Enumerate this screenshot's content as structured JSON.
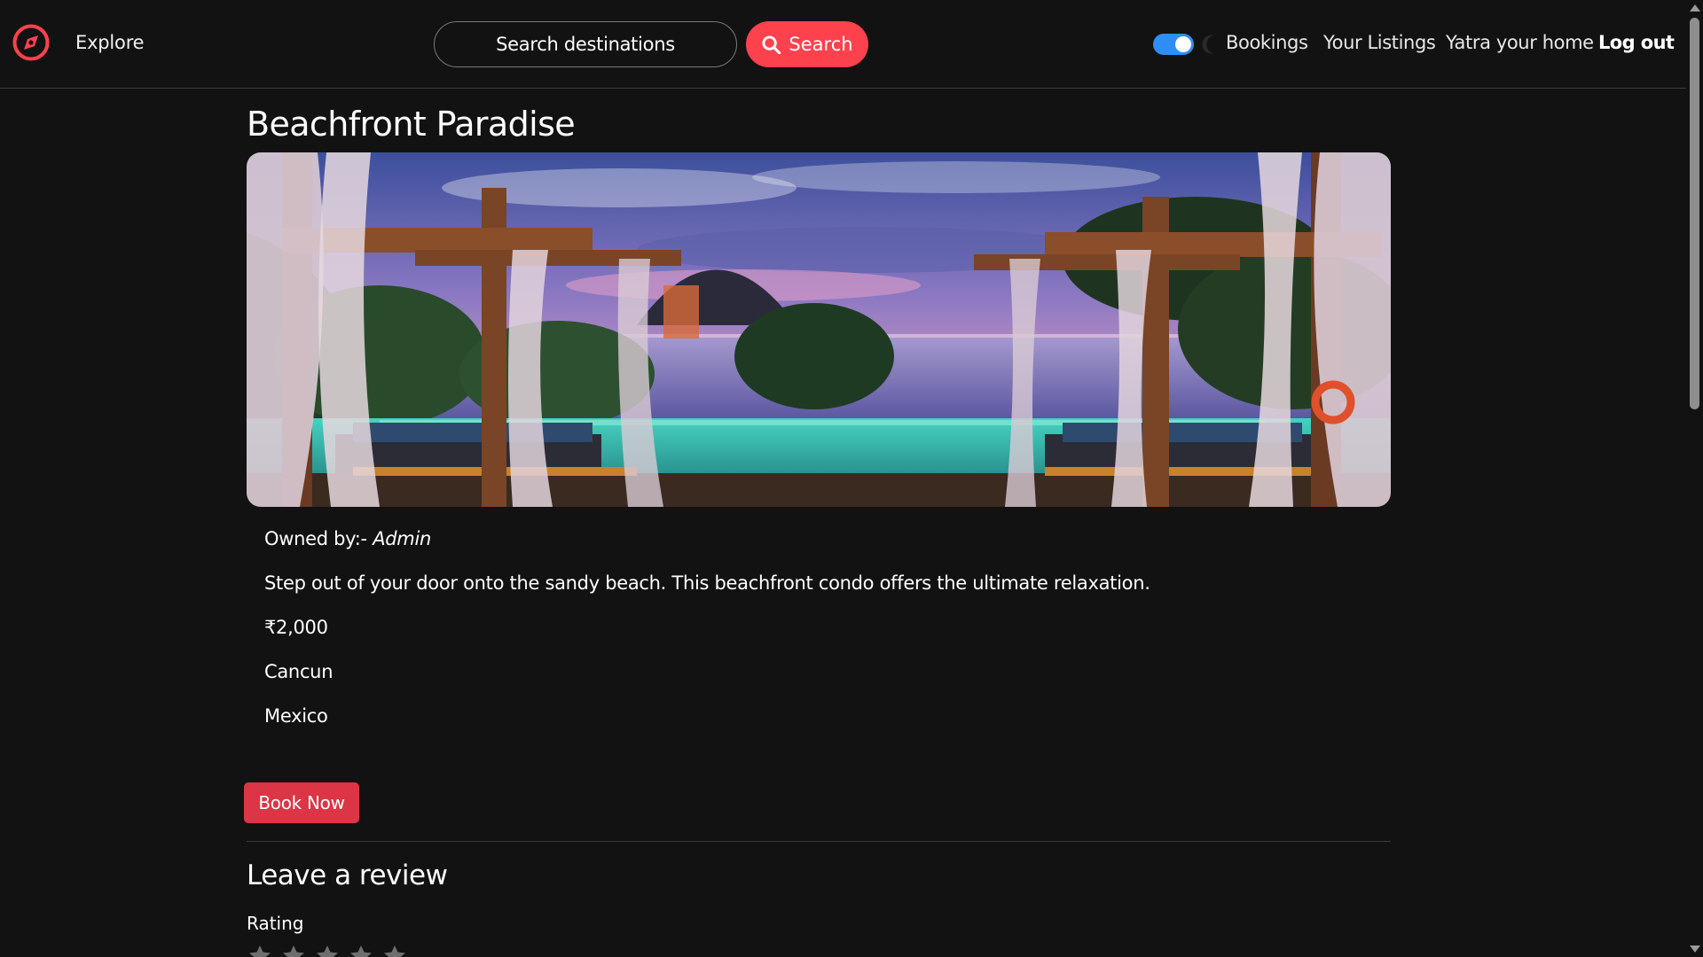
{
  "navbar": {
    "brand_icon": "compass-icon",
    "explore_label": "Explore",
    "search_placeholder": "Search destinations",
    "search_button_label": "Search",
    "search_icon": "magnifier-icon",
    "theme_toggle": {
      "state": "on",
      "icon": "moon-icon"
    },
    "links": {
      "bookings": "Bookings",
      "listings": "Your Listings",
      "yatra_home": "Yatra your home",
      "logout": "Log out"
    }
  },
  "listing": {
    "title": "Beachfront Paradise",
    "owner_prefix": "Owned by:- ",
    "owner_name": "Admin",
    "description": "Step out of your door onto the sandy beach. This beachfront condo offers the ultimate relaxation.",
    "price": "₹2,000",
    "city": "Cancun",
    "country": "Mexico",
    "book_label": "Book Now"
  },
  "review": {
    "heading": "Leave a review",
    "rating_label": "Rating",
    "star_count": 5
  },
  "colors": {
    "background": "#121212",
    "accent": "#fe424d",
    "book_button": "#dc3545",
    "toggle": "#2f8df8"
  }
}
